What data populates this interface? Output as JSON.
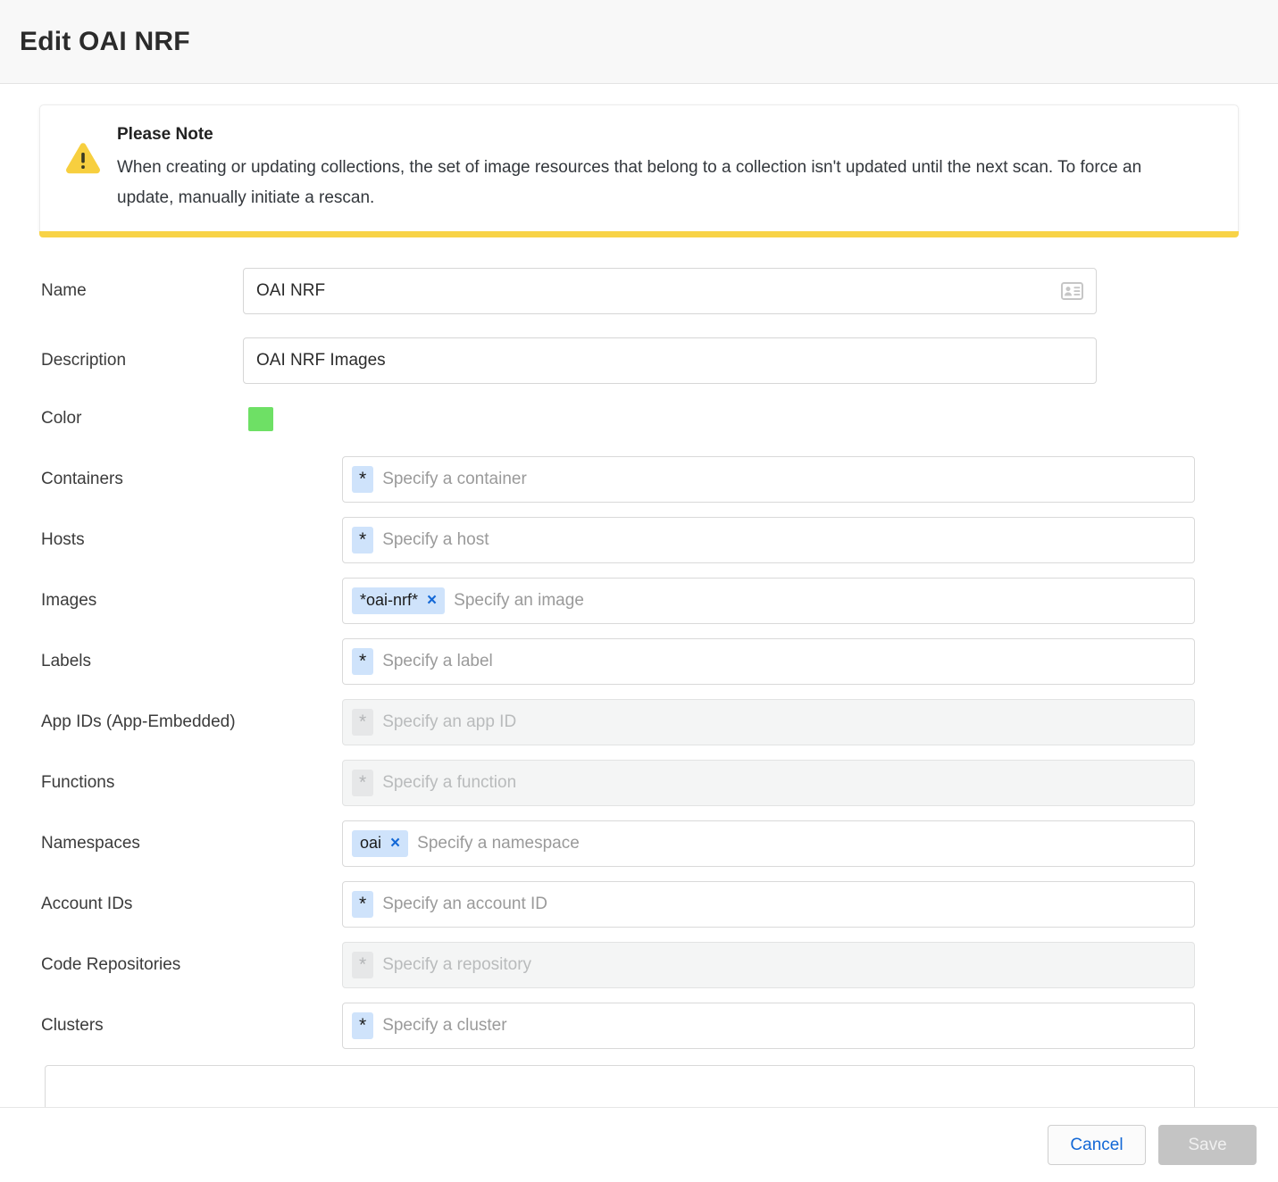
{
  "header": {
    "title": "Edit OAI NRF"
  },
  "notice": {
    "icon": "warning-triangle-icon",
    "title": "Please Note",
    "body": "When creating or updating collections, the set of image resources that belong to a collection isn't updated until the next scan. To force an update, manually initiate a rescan.",
    "accent_color": "#f8d347"
  },
  "form": {
    "name": {
      "label": "Name",
      "value": "OAI NRF",
      "icon": "contact-card-icon"
    },
    "description": {
      "label": "Description",
      "value": "OAI NRF Images"
    },
    "color": {
      "label": "Color",
      "value": "#6ee065"
    },
    "fields": [
      {
        "label": "Containers",
        "placeholder": "Specify a container",
        "chips": [
          {
            "text": "*",
            "removable": false
          }
        ],
        "disabled": false
      },
      {
        "label": "Hosts",
        "placeholder": "Specify a host",
        "chips": [
          {
            "text": "*",
            "removable": false
          }
        ],
        "disabled": false
      },
      {
        "label": "Images",
        "placeholder": "Specify an image",
        "chips": [
          {
            "text": "*oai-nrf*",
            "removable": true,
            "remove_label": "×"
          }
        ],
        "disabled": false
      },
      {
        "label": "Labels",
        "placeholder": "Specify a label",
        "chips": [
          {
            "text": "*",
            "removable": false
          }
        ],
        "disabled": false
      },
      {
        "label": "App IDs (App-Embedded)",
        "placeholder": "Specify an app ID",
        "chips": [
          {
            "text": "*",
            "removable": false
          }
        ],
        "disabled": true
      },
      {
        "label": "Functions",
        "placeholder": "Specify a function",
        "chips": [
          {
            "text": "*",
            "removable": false
          }
        ],
        "disabled": true
      },
      {
        "label": "Namespaces",
        "placeholder": "Specify a namespace",
        "chips": [
          {
            "text": "oai",
            "removable": true,
            "remove_label": "×"
          }
        ],
        "disabled": false
      },
      {
        "label": "Account IDs",
        "placeholder": "Specify an account ID",
        "chips": [
          {
            "text": "*",
            "removable": false
          }
        ],
        "disabled": false
      },
      {
        "label": "Code Repositories",
        "placeholder": "Specify a repository",
        "chips": [
          {
            "text": "*",
            "removable": false
          }
        ],
        "disabled": true
      },
      {
        "label": "Clusters",
        "placeholder": "Specify a cluster",
        "chips": [
          {
            "text": "*",
            "removable": false
          }
        ],
        "disabled": false
      }
    ]
  },
  "footer": {
    "cancel_label": "Cancel",
    "save_label": "Save",
    "save_disabled": true,
    "cancel_color": "#1368d6"
  }
}
